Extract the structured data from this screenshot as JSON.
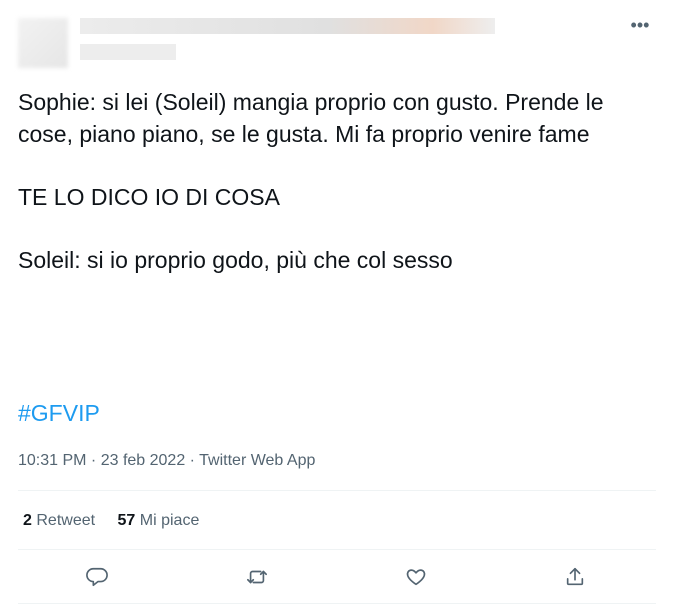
{
  "tweet": {
    "lines": [
      "Sophie: si lei (Soleil) mangia proprio con gusto. Prende le cose, piano piano, se le gusta. Mi fa proprio venire fame",
      "TE LO DICO IO DI COSA",
      "Soleil: si io proprio godo, più che col sesso"
    ],
    "hashtag": "#GFVIP",
    "timestamp": "10:31 PM · 23 feb 2022 · Twitter Web App"
  },
  "stats": {
    "retweets_count": "2",
    "retweets_label": "Retweet",
    "likes_count": "57",
    "likes_label": "Mi piace"
  },
  "icons": {
    "more": "more-icon",
    "reply": "reply-icon",
    "retweet": "retweet-icon",
    "like": "like-icon",
    "share": "share-icon"
  },
  "colors": {
    "accent": "#1d9bf0",
    "text": "#0f1419",
    "secondary": "#536471"
  }
}
